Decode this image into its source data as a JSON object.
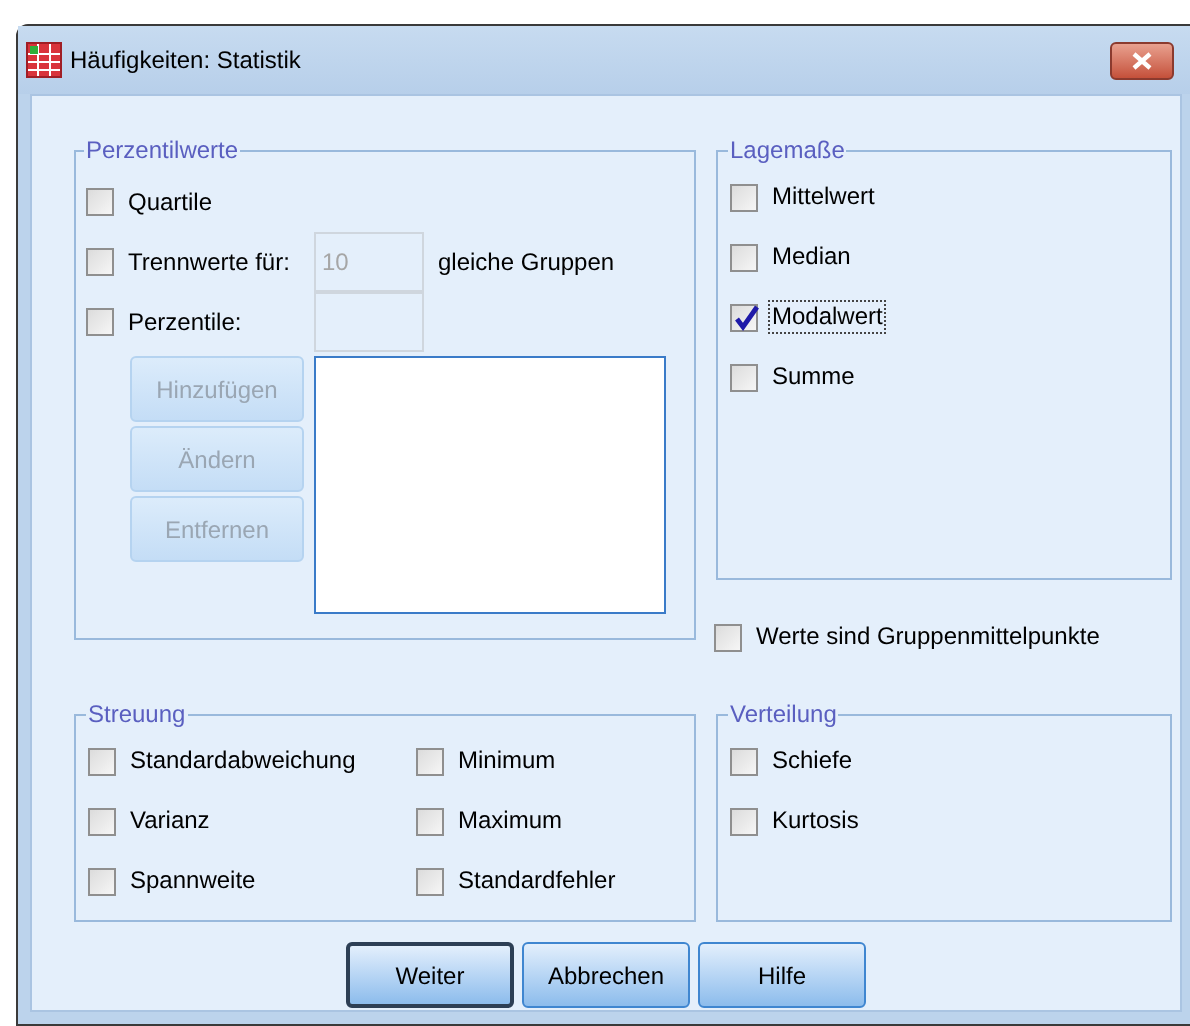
{
  "window": {
    "title": "Häufigkeiten: Statistik"
  },
  "percentile_values": {
    "legend": "Perzentilwerte",
    "options": [
      {
        "kind": "plain",
        "label": "Quartile",
        "checked": false
      },
      {
        "kind": "with_field",
        "label": "Trennwerte für:",
        "checked": false,
        "field_value": "10",
        "field_disabled": true,
        "suffix": "gleiche Gruppen"
      },
      {
        "kind": "with_field",
        "label": "Perzentile:",
        "checked": false,
        "field_disabled": true
      }
    ],
    "buttons": [
      {
        "label": "Hinzufügen",
        "disabled": true
      },
      {
        "label": "Ändern",
        "disabled": true
      },
      {
        "label": "Entfernen",
        "disabled": true
      }
    ]
  },
  "central_tendency": {
    "legend": "Lagemaße",
    "options": [
      {
        "label": "Mittelwert",
        "checked": false,
        "focused": false
      },
      {
        "label": "Median",
        "checked": false,
        "focused": false
      },
      {
        "label": "Modalwert",
        "checked": true,
        "focused": true
      },
      {
        "label": "Summe",
        "checked": false,
        "focused": false
      }
    ]
  },
  "group_midpoints": {
    "label": "Werte sind Gruppenmittelpunkte",
    "checked": false
  },
  "dispersion": {
    "legend": "Streuung",
    "options": [
      {
        "label": "Standardabweichung",
        "checked": false
      },
      {
        "label": "Minimum",
        "checked": false
      },
      {
        "label": "Varianz",
        "checked": false
      },
      {
        "label": "Maximum",
        "checked": false
      },
      {
        "label": "Spannweite",
        "checked": false
      },
      {
        "label": "Standardfehler",
        "checked": false
      }
    ]
  },
  "distribution": {
    "legend": "Verteilung",
    "options": [
      {
        "label": "Schiefe",
        "checked": false
      },
      {
        "label": "Kurtosis",
        "checked": false
      }
    ]
  },
  "buttons": [
    {
      "label": "Weiter",
      "default": true
    },
    {
      "label": "Abbrechen",
      "default": false
    },
    {
      "label": "Hilfe",
      "default": false
    }
  ]
}
